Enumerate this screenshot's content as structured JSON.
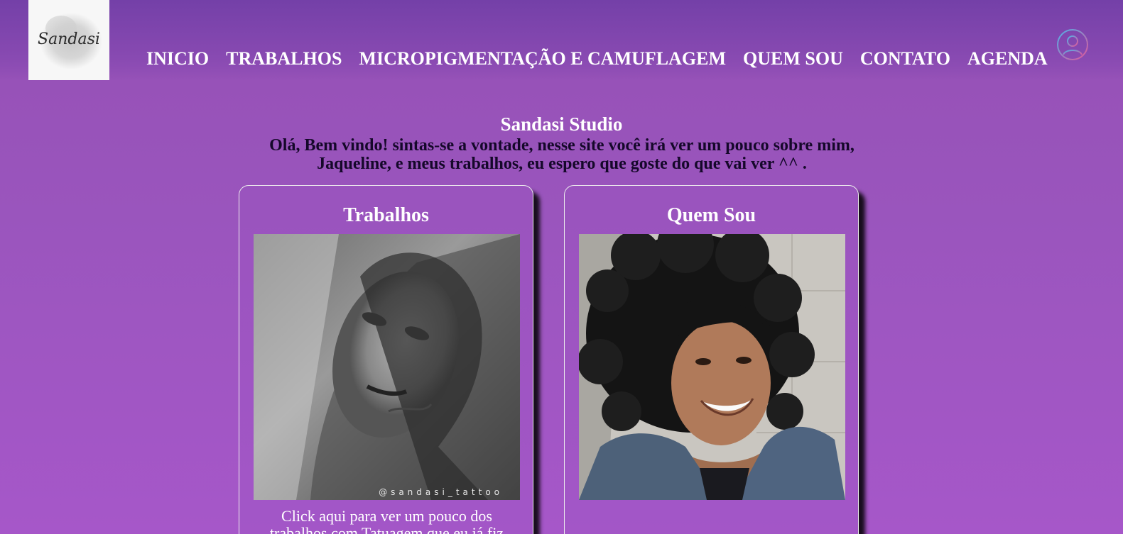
{
  "brand": {
    "logo_text": "Sandasi"
  },
  "nav": {
    "items": [
      {
        "label": "INICIO"
      },
      {
        "label": "TRABALHOS"
      },
      {
        "label": "MICROPIGMENTAÇÃO E CAMUFLAGEM"
      },
      {
        "label": "QUEM SOU"
      },
      {
        "label": "CONTATO"
      },
      {
        "label": "AGENDA"
      }
    ],
    "account_icon": "user-circle-icon"
  },
  "hero": {
    "title": "Sandasi Studio",
    "welcome": "Olá, Bem vindo! sintas-se a vontade, nesse site você irá ver um pouco sobre mim, Jaqueline, e meus trabalhos, eu espero que goste do que vai ver ^^ ."
  },
  "cards": [
    {
      "title": "Trabalhos",
      "image_watermark": "@sandasi_tattoo",
      "caption": "Click aqui para ver um pouco dos trabalhos com Tatuagem que eu já fiz"
    },
    {
      "title": "Quem Sou"
    }
  ],
  "colors": {
    "background_top": "#7a3fab",
    "background_bottom": "#a657c9",
    "welcome_text": "#15082a",
    "text": "#ffffff"
  }
}
